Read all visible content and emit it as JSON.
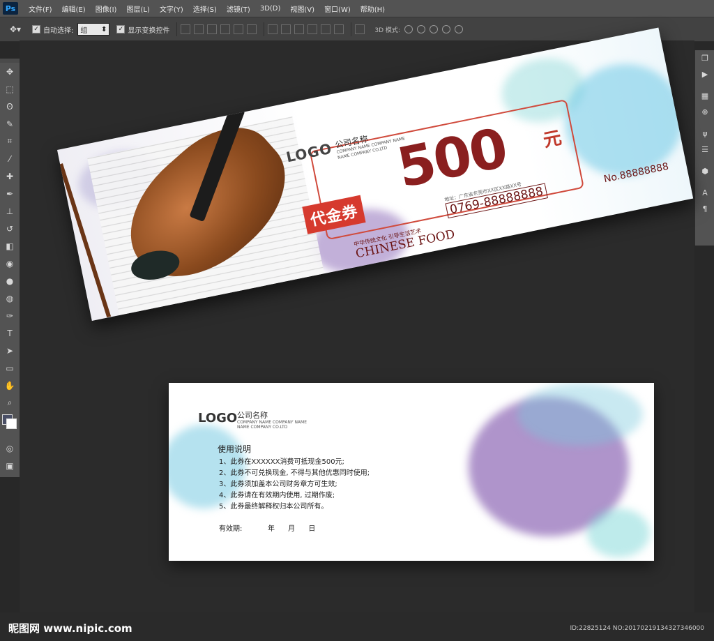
{
  "app": {
    "logo": "Ps"
  },
  "menu": [
    "文件(F)",
    "编辑(E)",
    "图像(I)",
    "图层(L)",
    "文字(Y)",
    "选择(S)",
    "滤镜(T)",
    "3D(D)",
    "视图(V)",
    "窗口(W)",
    "帮助(H)"
  ],
  "options": {
    "auto_select_label": "自动选择:",
    "auto_select_value": "组",
    "show_transform_label": "显示变换控件",
    "mode_3d_label": "3D 模式:"
  },
  "front": {
    "logo": "LOGO",
    "company": "公司名称",
    "company_en_1": "COMPANY NAME COMPANY NAME",
    "company_en_2": "NAME COMPANY CO.LTD",
    "voucher_label": "代金券",
    "amount": "500",
    "currency": "元",
    "address": "地址：广东省东莞市XX区XX路XX号",
    "phone": "0769-88888888",
    "slogan": "中华传统文化 引导生活艺术",
    "brand": "CHINESE FOOD",
    "serial": "No.88888888"
  },
  "back": {
    "logo": "LOGO",
    "company": "公司名称",
    "company_en_1": "COMPANY NAME COMPANY NAME",
    "company_en_2": "NAME COMPANY CO.LTD",
    "title": "使用说明",
    "rules": [
      "1、此券在XXXXXX消费可抵现金500元;",
      "2、此券不可兑换现金, 不得与其他优惠同时使用;",
      "3、此券须加盖本公司财务章方可生效;",
      "4、此券请在有效期内使用, 过期作废;",
      "5、此券最终解释权归本公司所有。"
    ],
    "validity_label": "有效期:",
    "validity_date": "年 月 日"
  },
  "footer": {
    "watermark": "昵图网 www.nipic.com",
    "image_id": "ID:22825124 NO:20170219134327346000"
  },
  "colors": {
    "ui_bg": "#282828",
    "menubar": "#535353",
    "accent_red": "#d63a2e",
    "amount_red": "#8a1f1f"
  }
}
